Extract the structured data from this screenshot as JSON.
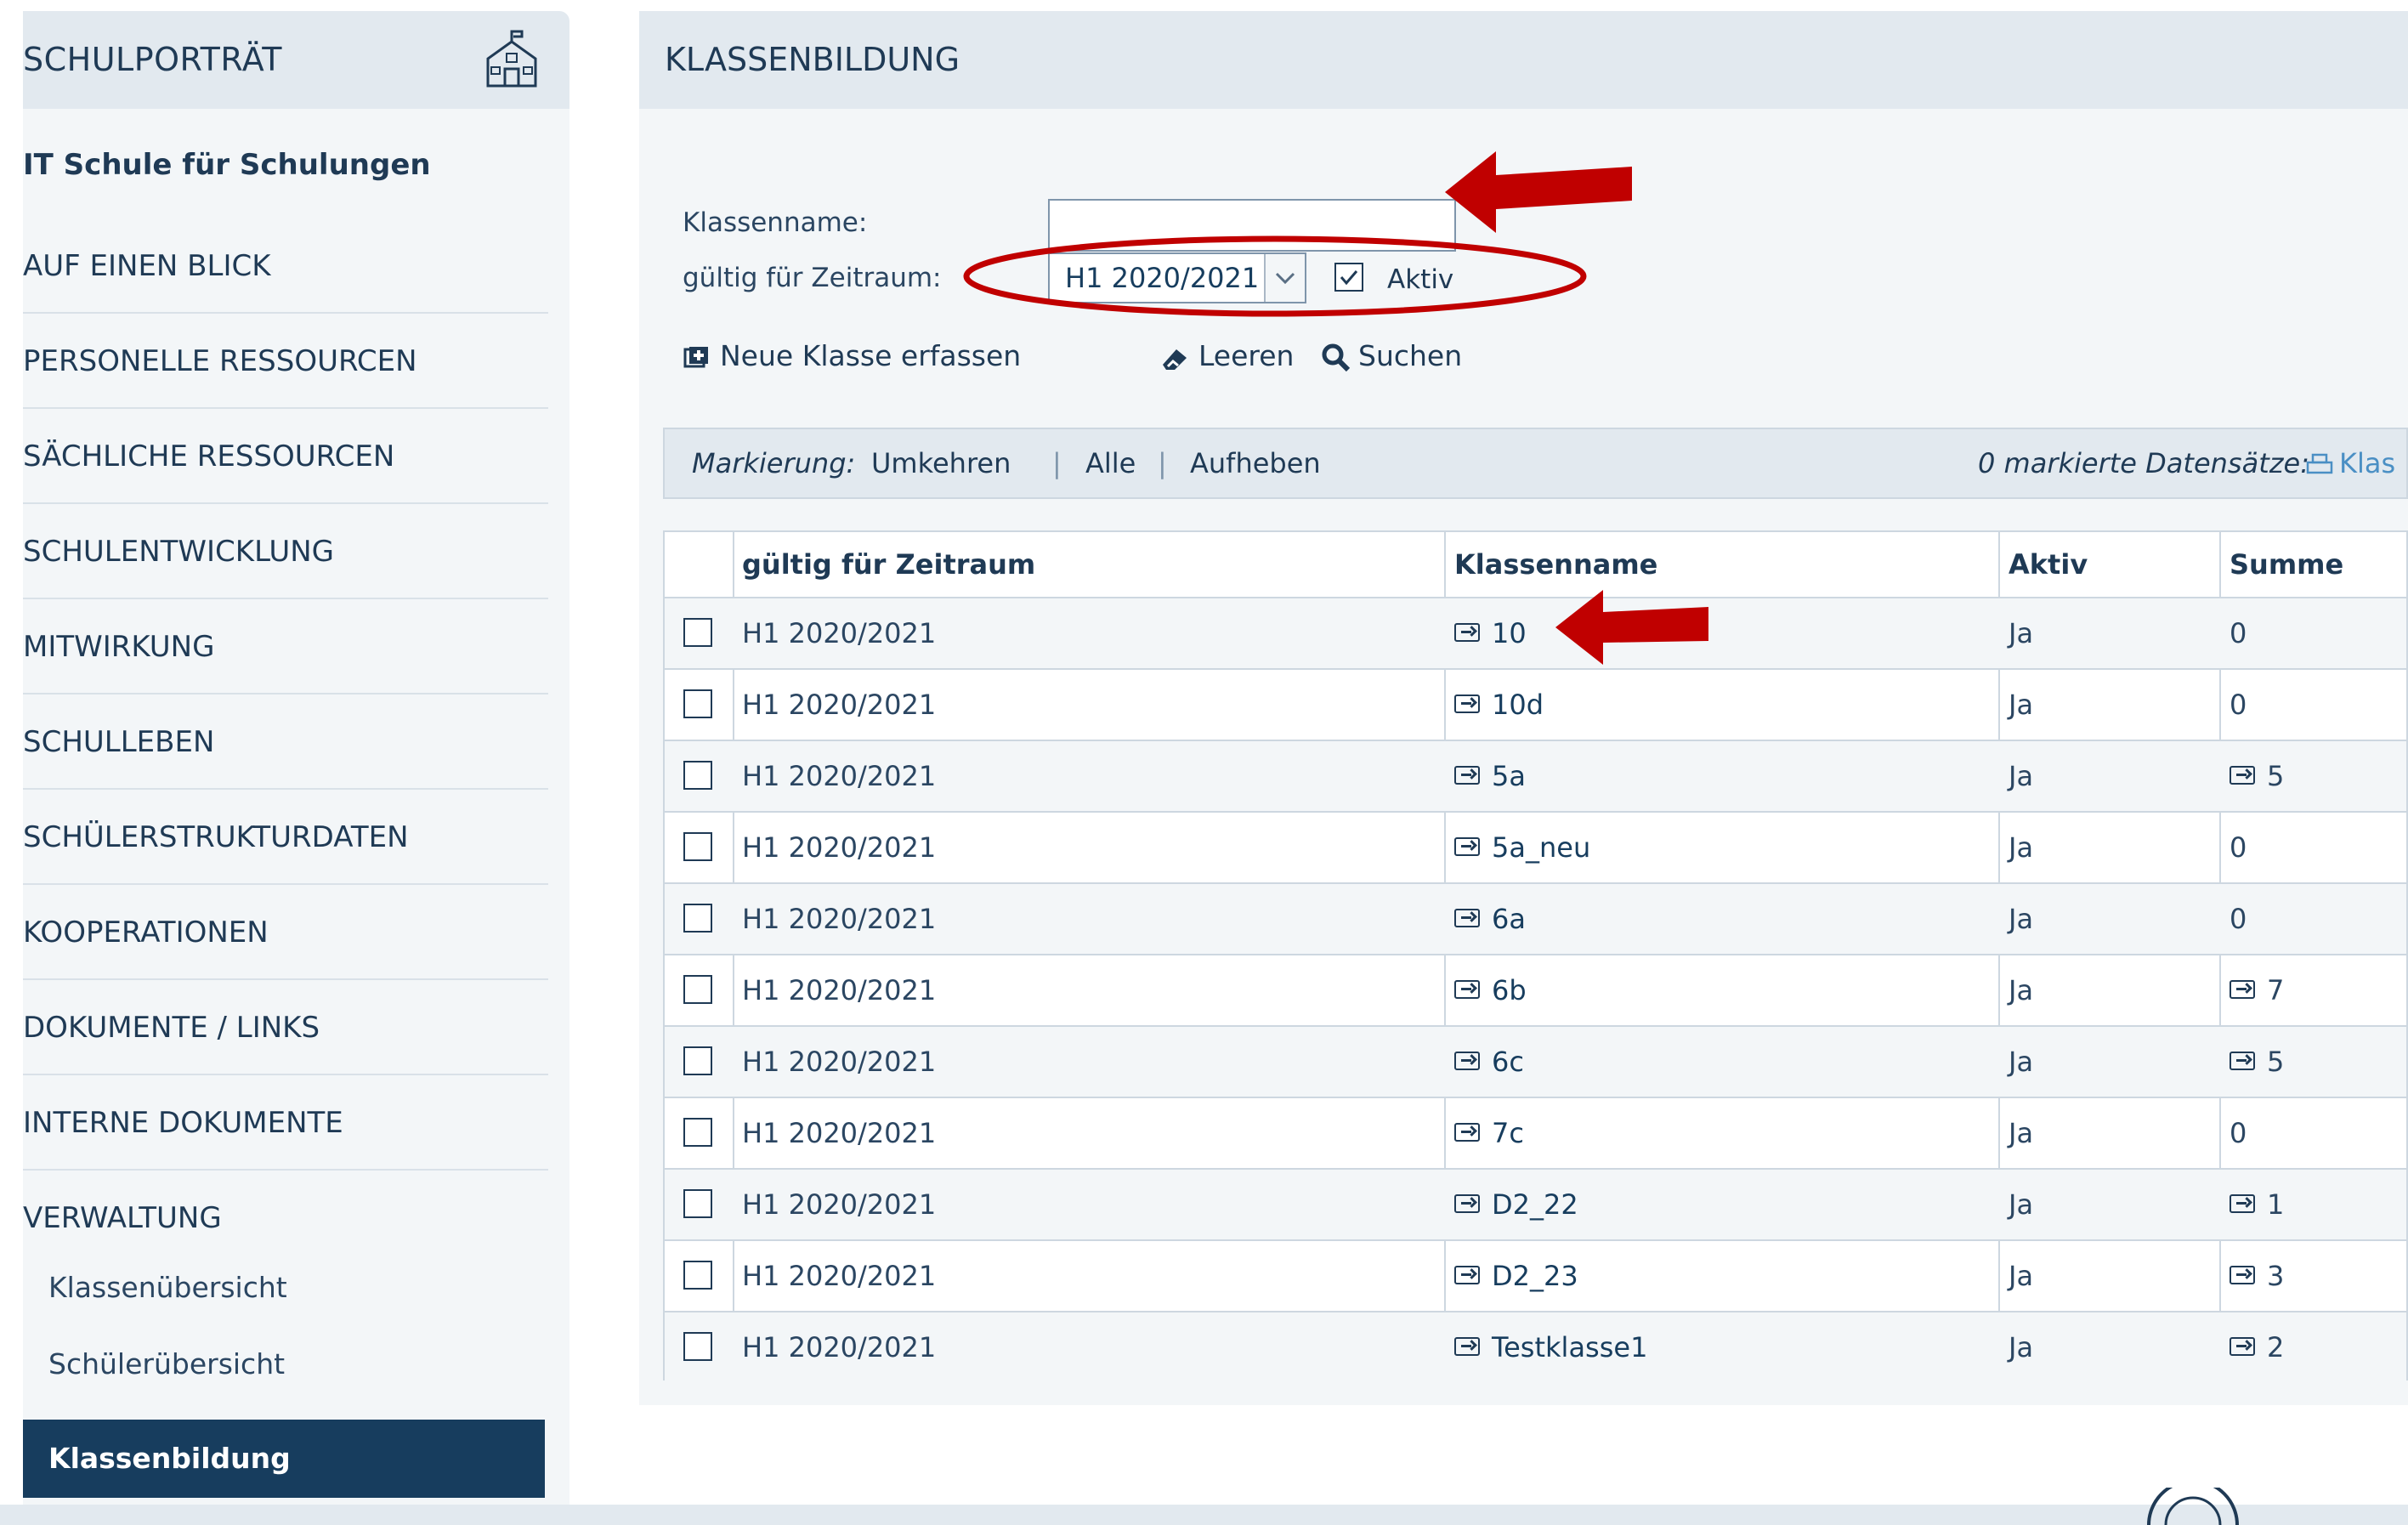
{
  "sidebar": {
    "header": "SCHULPORTRÄT",
    "school_name": "IT Schule für Schulungen",
    "items": [
      {
        "label": "AUF EINEN BLICK"
      },
      {
        "label": "PERSONELLE RESSOURCEN"
      },
      {
        "label": "SÄCHLICHE RESSOURCEN"
      },
      {
        "label": "SCHULENTWICKLUNG"
      },
      {
        "label": "MITWIRKUNG"
      },
      {
        "label": "SCHULLEBEN"
      },
      {
        "label": "SCHÜLERSTRUKTURDATEN"
      },
      {
        "label": "KOOPERATIONEN"
      },
      {
        "label": "DOKUMENTE / LINKS"
      },
      {
        "label": "INTERNE DOKUMENTE"
      },
      {
        "label": "VERWALTUNG"
      }
    ],
    "sub_items": [
      {
        "label": "Klassenübersicht"
      },
      {
        "label": "Schülerübersicht"
      }
    ],
    "active_item": "Klassenbildung"
  },
  "main": {
    "title": "KLASSENBILDUNG",
    "form": {
      "name_label": "Klassenname:",
      "name_value": "",
      "period_label": "gültig für Zeitraum:",
      "period_value": "H1 2020/2021",
      "aktiv_label": "Aktiv",
      "aktiv_checked": true
    },
    "toolbar": {
      "new_label": "Neue Klasse erfassen",
      "clear_label": "Leeren",
      "search_label": "Suchen"
    },
    "marking": {
      "label": "Markierung:",
      "invert": "Umkehren",
      "all": "Alle",
      "clear": "Aufheben",
      "count_text": "0 markierte Datensätze:",
      "action_text": "Klas"
    },
    "table": {
      "headers": [
        "gültig für Zeitraum",
        "Klassenname",
        "Aktiv",
        "Summe zuge"
      ],
      "rows": [
        {
          "period": "H1 2020/2021",
          "name": "10",
          "active": "Ja",
          "sum": "0",
          "sum_link": false
        },
        {
          "period": "H1 2020/2021",
          "name": "10d",
          "active": "Ja",
          "sum": "0",
          "sum_link": false
        },
        {
          "period": "H1 2020/2021",
          "name": "5a",
          "active": "Ja",
          "sum": "5",
          "sum_link": true
        },
        {
          "period": "H1 2020/2021",
          "name": "5a_neu",
          "active": "Ja",
          "sum": "0",
          "sum_link": false
        },
        {
          "period": "H1 2020/2021",
          "name": "6a",
          "active": "Ja",
          "sum": "0",
          "sum_link": false
        },
        {
          "period": "H1 2020/2021",
          "name": "6b",
          "active": "Ja",
          "sum": "7",
          "sum_link": true
        },
        {
          "period": "H1 2020/2021",
          "name": "6c",
          "active": "Ja",
          "sum": "5",
          "sum_link": true
        },
        {
          "period": "H1 2020/2021",
          "name": "7c",
          "active": "Ja",
          "sum": "0",
          "sum_link": false
        },
        {
          "period": "H1 2020/2021",
          "name": "D2_22",
          "active": "Ja",
          "sum": "1",
          "sum_link": true
        },
        {
          "period": "H1 2020/2021",
          "name": "D2_23",
          "active": "Ja",
          "sum": "3",
          "sum_link": true
        },
        {
          "period": "H1 2020/2021",
          "name": "Testklasse1",
          "active": "Ja",
          "sum": "2",
          "sum_link": true
        }
      ]
    }
  },
  "colors": {
    "primary": "#173d5e",
    "panel_bg": "#f3f6f8",
    "header_bg": "#e2e9ef",
    "annotation": "#c00000"
  }
}
